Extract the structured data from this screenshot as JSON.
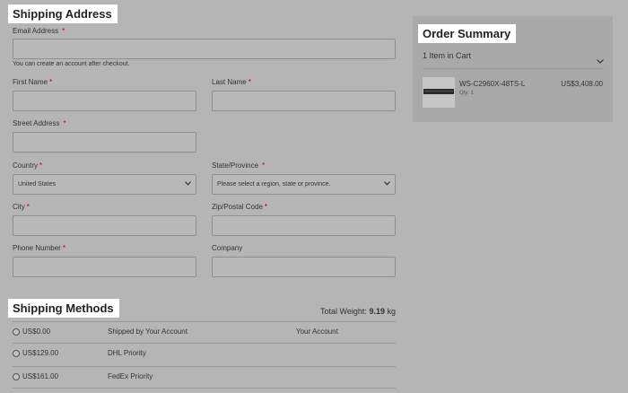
{
  "shipping_address": {
    "title": "Shipping Address",
    "email_label": "Email Address",
    "email_help": "You can create an account after checkout.",
    "first_name_label": "First Name",
    "last_name_label": "Last Name",
    "street_label": "Street Address",
    "country_label": "Country",
    "country_value": "United States",
    "state_label": "State/Province",
    "state_placeholder": "Please select a region, state or province.",
    "city_label": "City",
    "zip_label": "Zip/Postal Code",
    "phone_label": "Phone Number",
    "company_label": "Company",
    "required_mark": "*"
  },
  "shipping_methods": {
    "title": "Shipping Methods",
    "total_weight_label": "Total Weight:",
    "total_weight_value": "9.19",
    "total_weight_unit": "kg",
    "rows": [
      {
        "price": "US$0.00",
        "method": "Shipped by Your Account",
        "carrier": "Your Account"
      },
      {
        "price": "US$129.00",
        "method": "DHL Priority",
        "carrier": ""
      },
      {
        "price": "US$161.00",
        "method": "FedEx Priority",
        "carrier": ""
      }
    ]
  },
  "order_summary": {
    "title": "Order Summary",
    "cart_count_label": "1 Item in Cart",
    "item": {
      "name": "WS-C2960X-48TS-L",
      "qty_label": "Qty: 1",
      "price": "US$3,408.00"
    }
  },
  "icons": {
    "chevron": "chevron-down-icon",
    "radio": "radio-icon",
    "product": "switch-product-image"
  },
  "colors": {
    "overlay_background": "#b5b5b5",
    "required_star": "#b00000",
    "title_background": "#ffffff"
  }
}
